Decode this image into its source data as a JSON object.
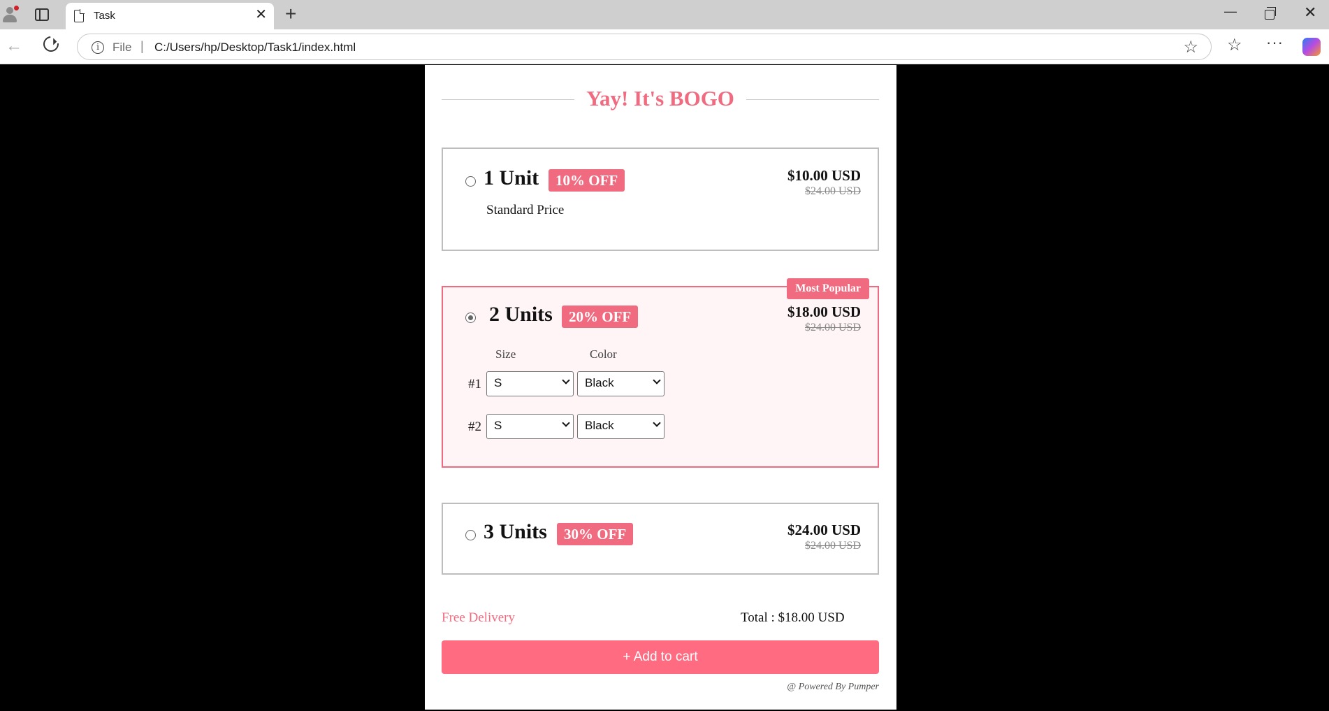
{
  "browser": {
    "tab_title": "Task",
    "tab_close": "✕",
    "new_tab": "+",
    "url_scheme": "File",
    "url_separator": "|",
    "url": "C:/Users/hp/Desktop/Task1/index.html",
    "window_minimize": "—",
    "window_close": "✕"
  },
  "page": {
    "heading": "Yay! It's BOGO",
    "offers": [
      {
        "units": "1 Unit",
        "discount": "10% OFF",
        "price": "$10.00 USD",
        "old_price": "$24.00 USD",
        "subtext": "Standard Price",
        "selected": false
      },
      {
        "units": "2 Units",
        "discount": "20% OFF",
        "price": "$18.00 USD",
        "old_price": "$24.00 USD",
        "badge": "Most Popular",
        "selected": true,
        "size_label": "Size",
        "color_label": "Color",
        "rows": [
          {
            "label": "#1",
            "size": "S",
            "color": "Black"
          },
          {
            "label": "#2",
            "size": "S",
            "color": "Black"
          }
        ]
      },
      {
        "units": "3 Units",
        "discount": "30% OFF",
        "price": "$24.00 USD",
        "old_price": "$24.00 USD",
        "selected": false
      }
    ],
    "delivery": "Free Delivery",
    "total": "Total : $18.00 USD",
    "add_to_cart": "+ Add to cart",
    "powered_by": "@ Powered By Pumper"
  },
  "colors": {
    "accent": "#f16b80",
    "button": "#ff6b81",
    "selected_bg": "#fff5f6"
  }
}
